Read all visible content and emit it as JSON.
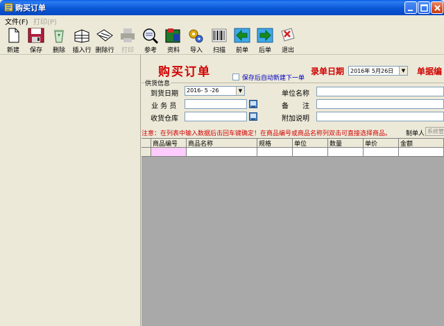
{
  "window": {
    "title": "购买订单"
  },
  "menu": {
    "file": "文件(F)",
    "print": "打印(P)"
  },
  "toolbar": {
    "new": "新建",
    "save": "保存",
    "delete": "删除",
    "insert_row": "插入行",
    "delete_row": "删除行",
    "print": "打印",
    "reference": "参考",
    "data": "资料",
    "import": "导入",
    "scan": "扫描",
    "prev": "前单",
    "next": "后单",
    "exit": "退出"
  },
  "form": {
    "title": "购买订单",
    "auto_new_label": "保存后自动新建下一单",
    "auto_new_checked": false,
    "entry_date_label": "录单日期",
    "entry_date_value": "2016年 5月26日",
    "doc_no_label": "单据编",
    "group_label": "供货信息",
    "arrival_date_label": "到货日期",
    "arrival_date_value": "2016- 5 -26",
    "salesman_label": "业 务 员",
    "salesman_value": "",
    "warehouse_label": "收货仓库",
    "warehouse_value": "",
    "company_label": "单位名称",
    "company_value": "",
    "remark_label": "备　　注",
    "remark_value": "",
    "extra_label": "附加说明",
    "extra_value": "",
    "note": "注意：在列表中输入数据后击回车键确定！在商品编号或商品名称列双击可直接选择商品。",
    "creator_label": "制单人",
    "creator_value": "系统管"
  },
  "grid": {
    "columns": [
      "商品编号",
      "商品名称",
      "规格",
      "单位",
      "数量",
      "单价",
      "金额"
    ]
  },
  "colors": {
    "accent_red": "#d00000",
    "link_blue": "#0000c0",
    "title_blue": "#0a5ee8",
    "selected_cell": "#ffccff"
  }
}
